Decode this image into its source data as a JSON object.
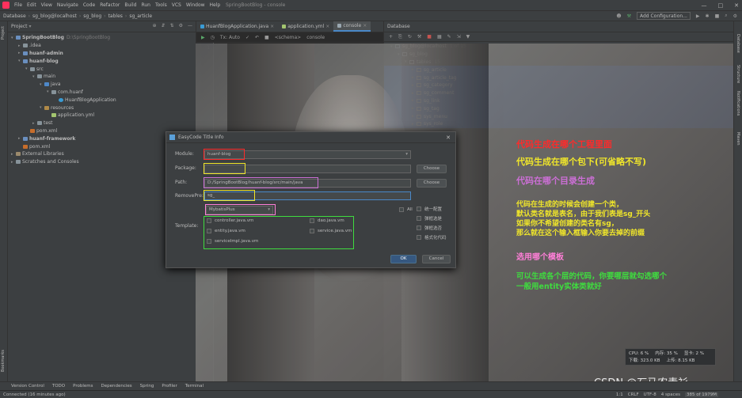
{
  "menu": {
    "items": [
      "File",
      "Edit",
      "View",
      "Navigate",
      "Code",
      "Refactor",
      "Build",
      "Run",
      "Tools",
      "VCS",
      "Window",
      "Help"
    ],
    "window_title": "SpringBootBlog - console",
    "controls": [
      "—",
      "□",
      "✕"
    ]
  },
  "nav": {
    "crumbs": [
      "Database",
      "sg_blog@localhost",
      "sg_blog",
      "tables",
      "sg_article"
    ],
    "add_config": "Add Configuration..."
  },
  "left_strip": {
    "project": "Project",
    "bookmarks": "Bookmarks"
  },
  "right_strip": {
    "database": "Database",
    "structure": "Structure",
    "notifications": "Notifications",
    "maven": "Maven"
  },
  "project": {
    "title": "Project",
    "tree": [
      {
        "label": "SpringBootBlog",
        "dim": "D:\\SpringBootBlog",
        "depth": 0,
        "arrow": "▾",
        "icon": "mod",
        "bold": true
      },
      {
        "label": ".idea",
        "depth": 1,
        "arrow": "▸",
        "icon": "dir"
      },
      {
        "label": "huanf-admin",
        "depth": 1,
        "arrow": "▸",
        "icon": "mod",
        "bold": true
      },
      {
        "label": "huanf-blog",
        "depth": 1,
        "arrow": "▾",
        "icon": "mod",
        "bold": true
      },
      {
        "label": "src",
        "depth": 2,
        "arrow": "▾",
        "icon": "dir"
      },
      {
        "label": "main",
        "depth": 3,
        "arrow": "▾",
        "icon": "dir"
      },
      {
        "label": "java",
        "depth": 4,
        "arrow": "▾",
        "icon": "src"
      },
      {
        "label": "com.huanf",
        "depth": 5,
        "arrow": "▾",
        "icon": "dir"
      },
      {
        "label": "HuanfBlogApplication",
        "depth": 6,
        "arrow": "",
        "icon": "cls"
      },
      {
        "label": "resources",
        "depth": 4,
        "arrow": "▾",
        "icon": "res"
      },
      {
        "label": "application.yml",
        "depth": 5,
        "arrow": "",
        "icon": "yml"
      },
      {
        "label": "test",
        "depth": 3,
        "arrow": "▸",
        "icon": "dir"
      },
      {
        "label": "pom.xml",
        "depth": 2,
        "arrow": "",
        "icon": "xml"
      },
      {
        "label": "huanf-framework",
        "depth": 1,
        "arrow": "▸",
        "icon": "mod",
        "bold": true
      },
      {
        "label": "pom.xml",
        "depth": 1,
        "arrow": "",
        "icon": "xml"
      },
      {
        "label": "External Libraries",
        "depth": 0,
        "arrow": "▸",
        "icon": "lib"
      },
      {
        "label": "Scratches and Consoles",
        "depth": 0,
        "arrow": "▸",
        "icon": "dir"
      }
    ]
  },
  "editor": {
    "tabs": [
      "HuanfBlogApplication.java",
      "application.yml",
      "console"
    ],
    "active_tab": "console",
    "toolbar": {
      "tx": "Tx: Auto",
      "schema": "<schema>",
      "console": "console"
    },
    "line_no": "1"
  },
  "database": {
    "title": "Database",
    "tree": [
      {
        "label": "sg_blog@localhost",
        "dim": "1 of 15",
        "depth": 0,
        "arrow": "▾"
      },
      {
        "label": "sg_blog",
        "depth": 1,
        "arrow": "▾"
      },
      {
        "label": "tables",
        "dim": "15",
        "depth": 2,
        "arrow": "▾"
      },
      {
        "label": "sg_article",
        "depth": 3,
        "arrow": "▸",
        "selected": true
      },
      {
        "label": "sg_article_tag",
        "depth": 3,
        "arrow": "▸",
        "selected": true
      },
      {
        "label": "sg_category",
        "depth": 3,
        "arrow": "▸",
        "selected": true
      },
      {
        "label": "sg_comment",
        "depth": 3,
        "arrow": "▸",
        "selected": true
      },
      {
        "label": "sg_link",
        "depth": 3,
        "arrow": "▸",
        "selected": true
      },
      {
        "label": "sg_tag",
        "depth": 3,
        "arrow": "▸",
        "selected": true
      },
      {
        "label": "sys_menu",
        "depth": 3,
        "arrow": "▸",
        "selected": true
      },
      {
        "label": "sys_role",
        "depth": 3,
        "arrow": "▸",
        "selected": true
      }
    ]
  },
  "dialog": {
    "title": "EasyCode Title Info",
    "module_label": "Module:",
    "module_value": "huanf-blog",
    "package_label": "Package:",
    "package_value": "",
    "path_label": "Path:",
    "path_value": "D:/SpringBootBlog/huanf-blog/src/main/java",
    "removepre_label": "RemovePre:",
    "removepre_value": "sg_",
    "group_value": "MybatisPlus",
    "all_label": "All",
    "template_label": "Template:",
    "templates": [
      "controller.java.vm",
      "dao.java.vm",
      "entity.java.vm",
      "service.java.vm",
      "serviceImpl.java.vm"
    ],
    "options": [
      "统一配置",
      "弹框选是",
      "弹框选否",
      "格式化代码"
    ],
    "choose_label": "Choose",
    "ok_label": "OK",
    "cancel_label": "Cancel"
  },
  "annotations": {
    "module": "代码生成在哪个工程里面",
    "package": "代码生成在哪个包下(可省略不写)",
    "path": "代码在哪个目录生成",
    "removepre": [
      "代码在生成的时候会创建一个类，",
      "默认类名就是表名，由于我们表是sg_开头",
      "如果你不希望创建的类名有sg，",
      "那么就在这个输入框输入你要去掉的前缀"
    ],
    "template": "选用哪个模板",
    "layers": [
      "可以生成各个层的代码，你要哪层就勾选哪个",
      "一般用entity实体类就好"
    ]
  },
  "colors": {
    "red": "#ff2a2a",
    "yellow": "#f0e62a",
    "violet": "#cc6fd6",
    "pink": "#ff7fd8",
    "green": "#3fdc3f",
    "selection": "#2f65ca"
  },
  "sysmon": {
    "cpu": "CPU: 6 %",
    "mem": "内存: 35 %",
    "gpu": "显卡: 2 %",
    "down": "下载: 323.0 KB",
    "up": "上传: 8.15 KB"
  },
  "watermark": "CSDN @石马农青衫",
  "toolwindows": [
    "Version Control",
    "TODO",
    "Problems",
    "Dependencies",
    "Spring",
    "Profiler",
    "Terminal"
  ],
  "status": {
    "message": "Connected (16 minutes ago)",
    "right": [
      "1:1",
      "CRLF",
      "UTF-8",
      "4 spaces",
      "385 of 1979M"
    ]
  }
}
